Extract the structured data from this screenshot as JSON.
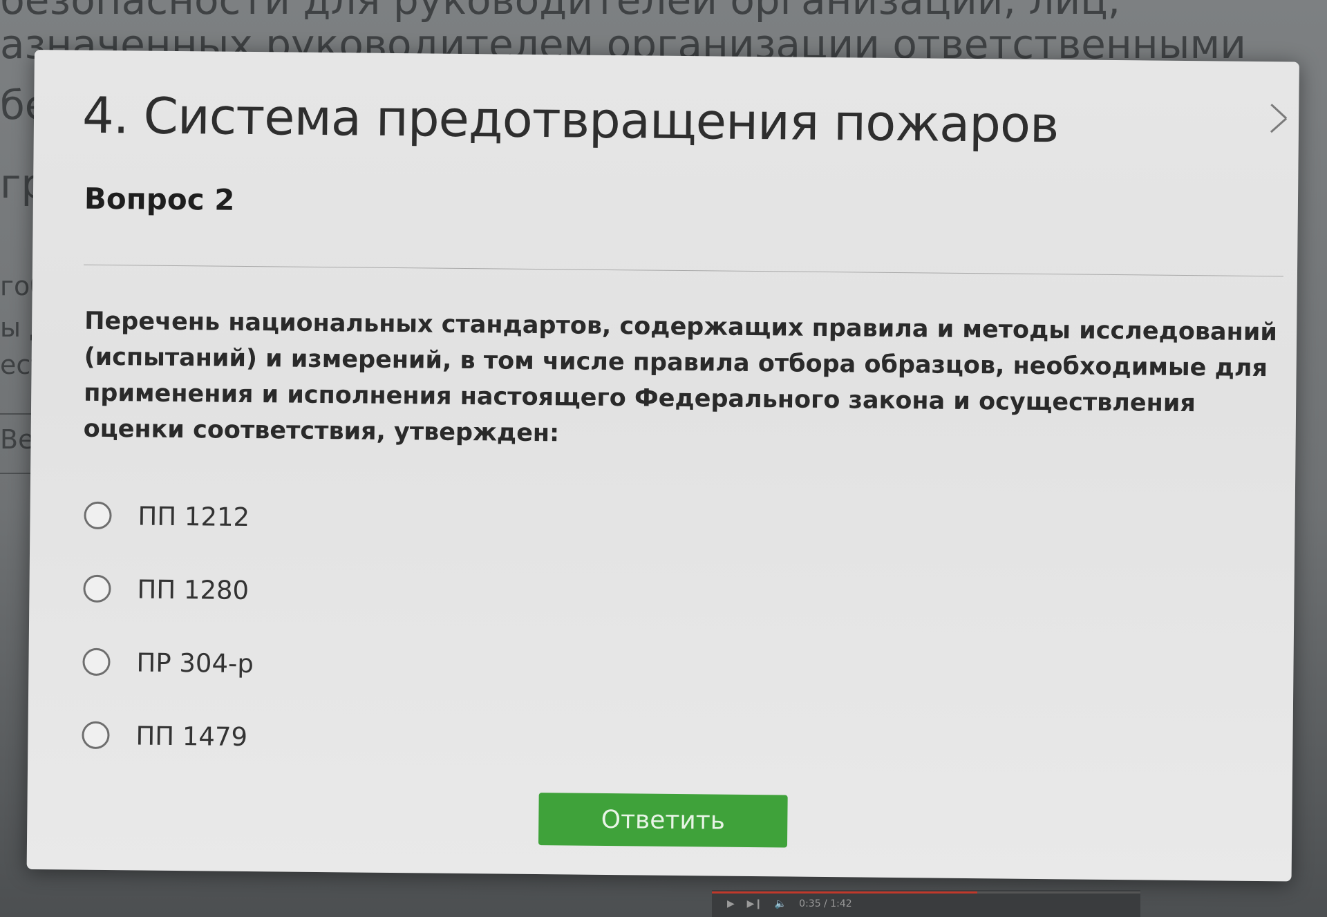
{
  "background": {
    "lines": [
      "безопасности для руководителей организаций, лиц,",
      "азначенных руководителем организации ответственными",
      "бе",
      "гр"
    ],
    "side_fragments": [
      "гоб",
      "ы д",
      "ест",
      "Вер"
    ]
  },
  "modal": {
    "title": "4. Система предотвращения пожаров",
    "question_number": "Вопрос 2",
    "question_text": "Перечень национальных стандартов, содержащих правила и методы исследований (испытаний) и измерений, в том числе правила отбора образцов, необходимые для применения и исполнения настоящего Федерального закона и осуществления оценки соответствия, утвержден:",
    "answers": [
      {
        "label": "ПП 1212",
        "selected": false
      },
      {
        "label": "ПП 1280",
        "selected": false
      },
      {
        "label": "ПР 304-р",
        "selected": false
      },
      {
        "label": "ПП 1479",
        "selected": false
      }
    ],
    "submit_label": "Ответить",
    "close_icon": "close-icon"
  },
  "media": {
    "progress": 0.62,
    "time": "0:35 / 1:42"
  },
  "colors": {
    "accent": "#3fa23a",
    "modal_bg": "#e4e4e4",
    "overlay": "#6f7274"
  }
}
